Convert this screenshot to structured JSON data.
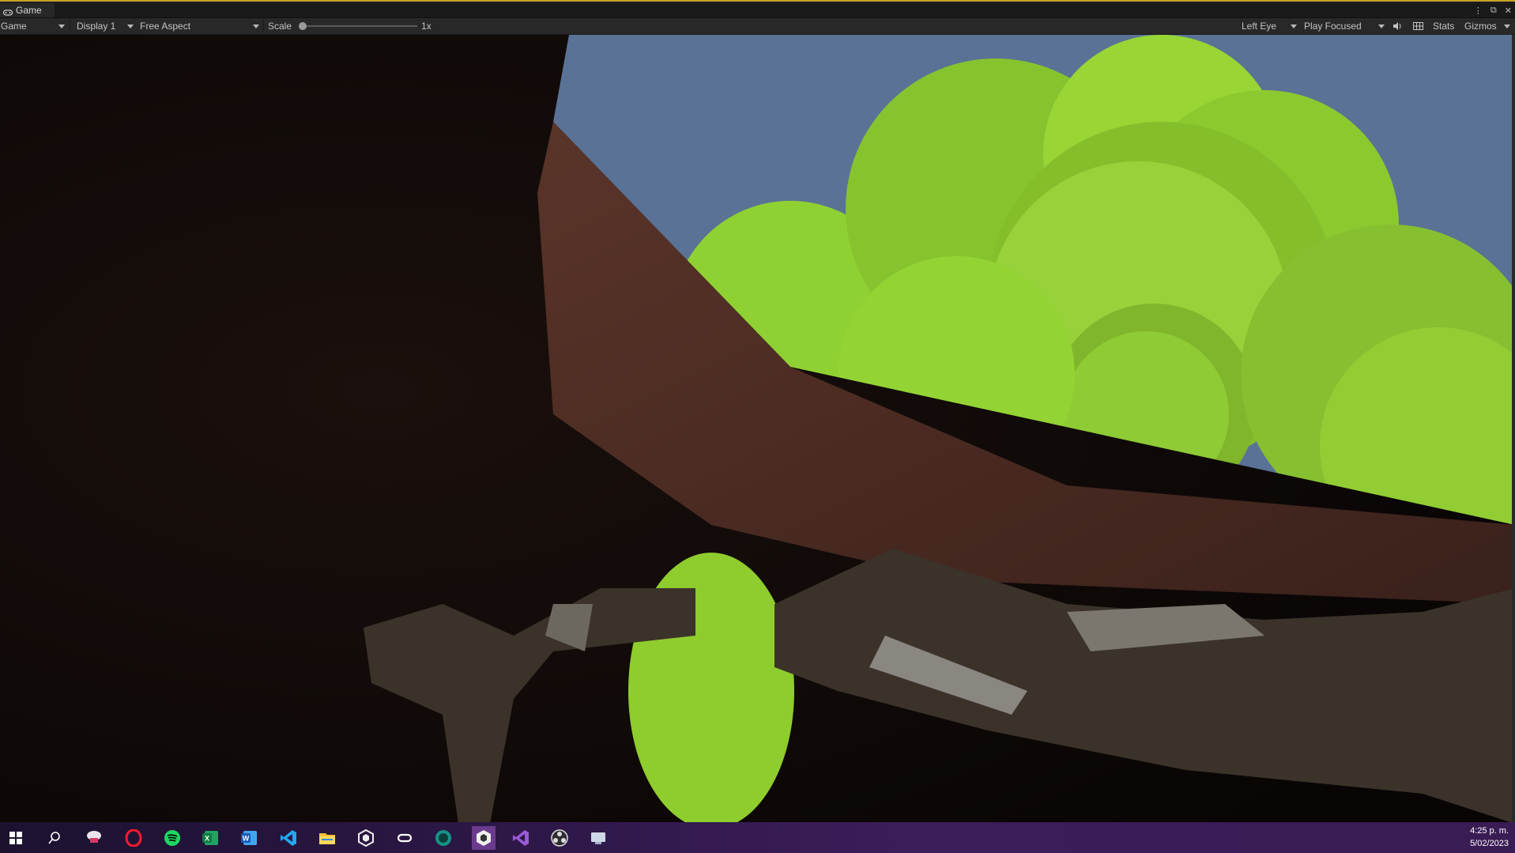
{
  "window": {
    "tab_label": "Game"
  },
  "toolbar": {
    "view_mode": "Game",
    "display": "Display 1",
    "aspect": "Free Aspect",
    "scale_label": "Scale",
    "scale_value": "1x",
    "scale_fraction": 0,
    "eye": "Left Eye",
    "play_mode": "Play Focused",
    "stats_label": "Stats",
    "gizmos_label": "Gizmos"
  },
  "taskbar": {
    "icons": [
      "windows-start-icon",
      "search-icon",
      "app-icon",
      "opera-icon",
      "spotify-icon",
      "excel-icon",
      "word-icon",
      "vscode-icon",
      "file-explorer-icon",
      "unity-hub-icon",
      "oculus-icon",
      "gitkraken-icon",
      "unity-icon",
      "visual-studio-icon",
      "obs-icon",
      "desktop-app-icon"
    ],
    "time": "4:25 p. m.",
    "date": "5/02/2023"
  },
  "colors": {
    "accent_border": "#c9a227",
    "sky": "#5a7295",
    "foliage": "#8fce2e",
    "branch": "#4a2a23",
    "taskbar": "#2b1744"
  }
}
